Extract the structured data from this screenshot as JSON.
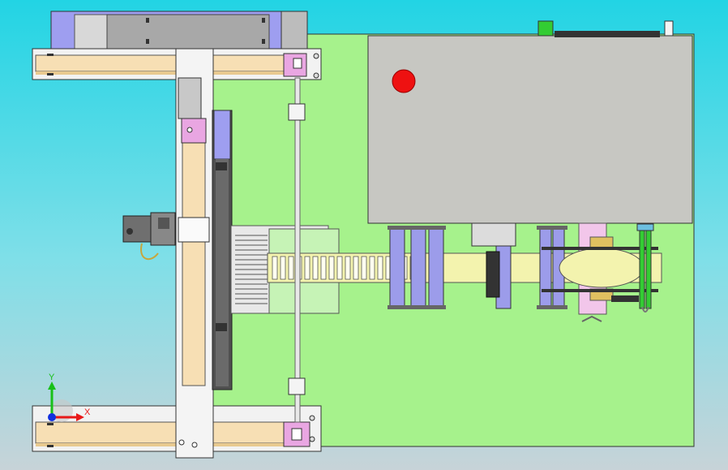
{
  "triad": {
    "x_label": "X",
    "y_label": "Y",
    "x_color": "#e81818",
    "y_color": "#18c018",
    "origin_color": "#1030e0"
  },
  "colors": {
    "background_top": "#22d4e4",
    "background_bottom": "#c7d3d8",
    "base_plate": "#a6f28c",
    "control_box": "#c7c7c2",
    "rail_beam": "#f7dfb4",
    "motor_panel": "#9e9ef0",
    "block_magenta": "#e9a6e2",
    "roller_blue": "#9c9cea",
    "belt_yellow": "#f3f3ae",
    "emergency_stop": "#ee1111",
    "indicator_green": "#33cc33"
  }
}
